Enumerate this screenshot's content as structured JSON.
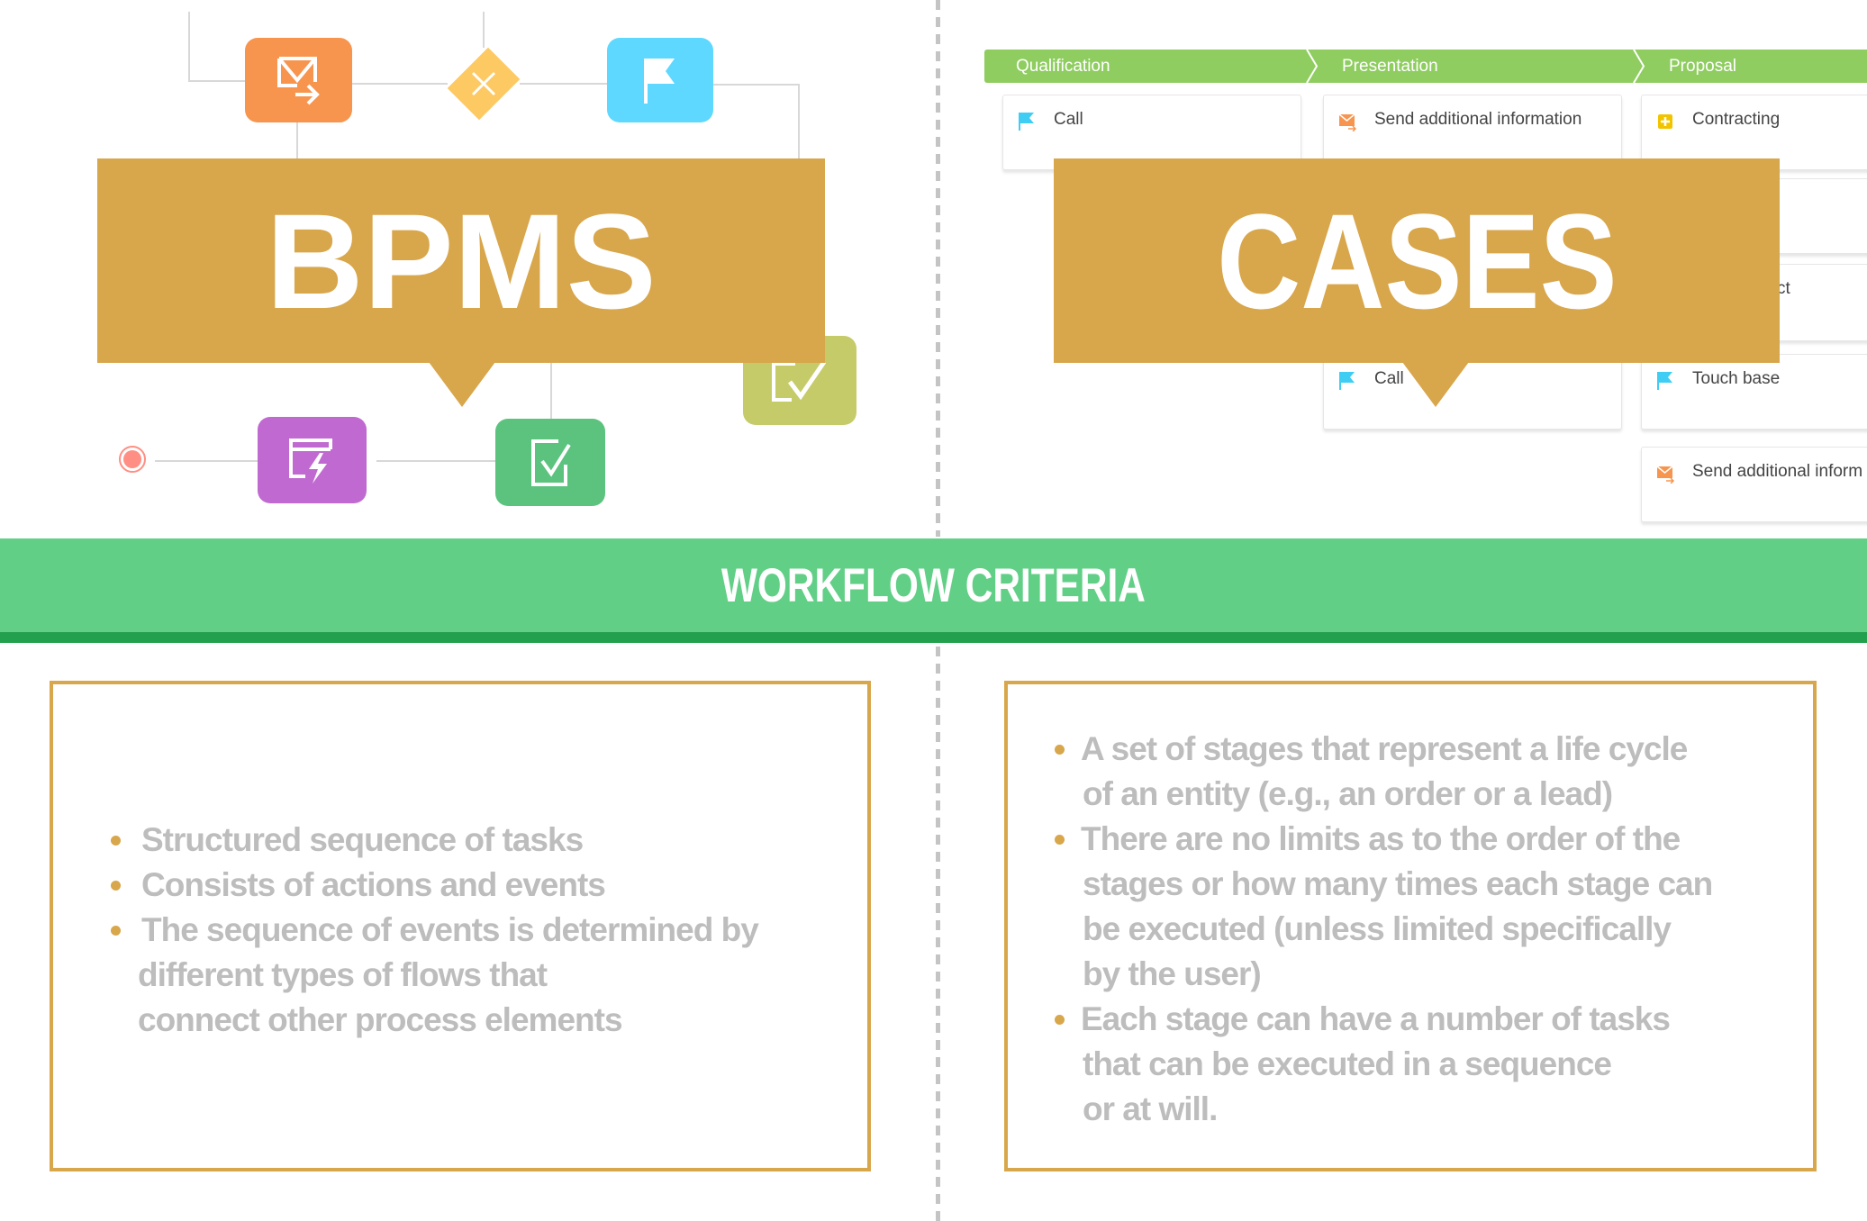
{
  "colors": {
    "banner": "#d8a64b",
    "band": "#62cf87",
    "band_dark": "#23a04d",
    "stage": "#8fcd60",
    "text_gray": "#bdbdbd",
    "divider": "#c4c4c4"
  },
  "bpms": {
    "title": "BPMS",
    "nodes": [
      {
        "icon": "send-email-icon",
        "color": "#f7954f"
      },
      {
        "icon": "exclusive-gateway-icon",
        "color": "#fdc963"
      },
      {
        "icon": "flag-icon",
        "color": "#5fd8ff"
      },
      {
        "icon": "checklist-icon",
        "color": "#c6cb69"
      },
      {
        "icon": "script-task-icon",
        "color": "#c06ad1"
      },
      {
        "icon": "user-task-check-icon",
        "color": "#5cc37f"
      },
      {
        "icon": "end-event-icon",
        "color": "#ff8f84"
      }
    ]
  },
  "cases": {
    "title": "CASES",
    "stages": [
      "Qualification",
      "Presentation",
      "Proposal"
    ],
    "cards": [
      {
        "label": "Call",
        "icon": "flag-icon"
      },
      {
        "label": "Send additional information",
        "icon": "email-icon"
      },
      {
        "label": "Contracting",
        "icon": "plus-task-icon"
      },
      {
        "label": "ct",
        "icon": ""
      },
      {
        "label": "Call",
        "icon": "flag-icon"
      },
      {
        "label": "Touch base",
        "icon": "flag-icon"
      },
      {
        "label": "Send additional inform",
        "icon": "email-icon"
      }
    ]
  },
  "band": {
    "title": "WORKFLOW CRITERIA"
  },
  "left_box": {
    "bullets": [
      {
        "lines": [
          "Structured sequence of tasks"
        ]
      },
      {
        "lines": [
          "Consists of actions and events"
        ]
      },
      {
        "lines": [
          "The sequence of events is determined by",
          "different types of flows that",
          "connect other process elements"
        ]
      }
    ]
  },
  "right_box": {
    "bullets": [
      {
        "lines": [
          "A set of stages that represent a life cycle",
          "of an entity (e.g., an order or a lead)"
        ]
      },
      {
        "lines": [
          "There are no limits as to the order of the",
          "stages or how many times each stage can",
          "be executed (unless limited specifically",
          "by the user)"
        ]
      },
      {
        "lines": [
          "Each stage can have a number of tasks",
          "that can be executed in a sequence",
          "or at will."
        ]
      }
    ]
  }
}
